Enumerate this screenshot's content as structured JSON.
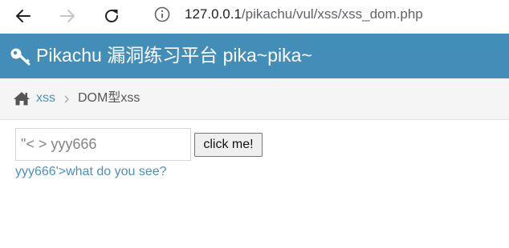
{
  "browser": {
    "url_host": "127.0.0.1",
    "url_path": "/pikachu/vul/xss/xss_dom.php",
    "icons": {
      "back": "arrow-left-icon",
      "forward": "arrow-right-icon",
      "reload": "reload-icon",
      "info": "info-icon"
    }
  },
  "header": {
    "title": "Pikachu 漏洞练习平台 pika~pika~",
    "icon": "key-icon",
    "background": "#438eb9"
  },
  "breadcrumb": {
    "home_icon": "home-icon",
    "link_label": "xss",
    "current_label": "DOM型xss"
  },
  "main": {
    "input_value": "\"< > yyy666",
    "button_label": "click me!",
    "result_link_text": "yyy666'>what do you see?"
  },
  "colors": {
    "link": "#4c8fbd",
    "breadcrumb_bg": "#f5f5f5"
  }
}
